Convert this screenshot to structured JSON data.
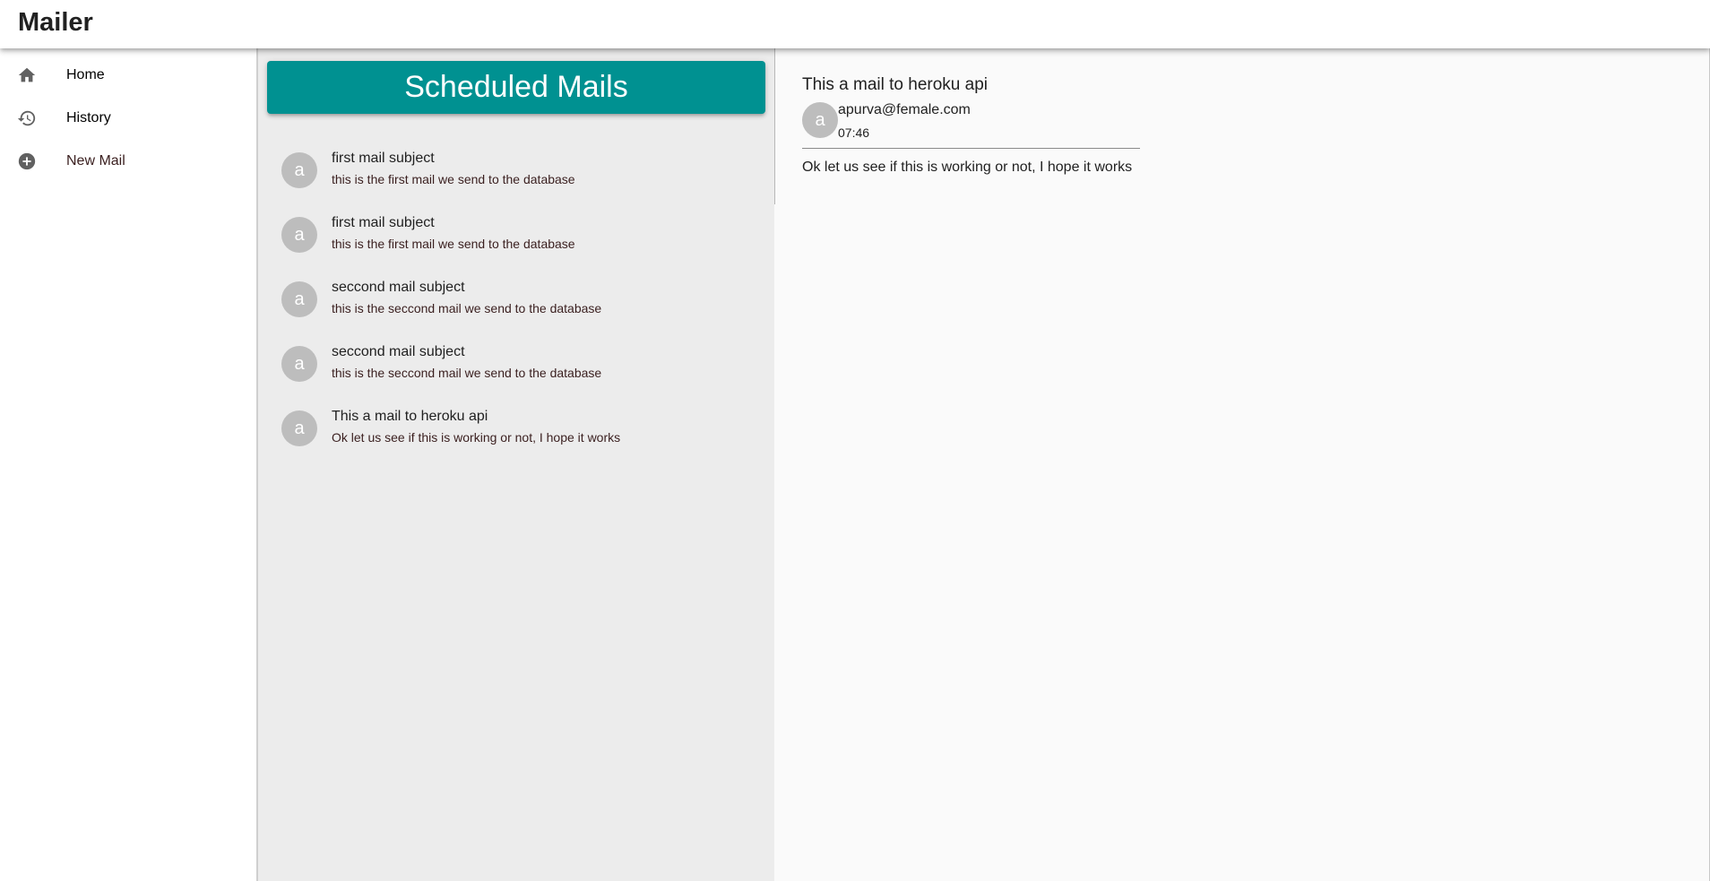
{
  "app": {
    "title": "Mailer"
  },
  "sidebar": {
    "items": [
      {
        "label": "Home",
        "icon": "home-icon"
      },
      {
        "label": "History",
        "icon": "history-icon"
      },
      {
        "label": "New Mail",
        "icon": "add-circle-icon"
      }
    ]
  },
  "list": {
    "header": "Scheduled Mails",
    "mails": [
      {
        "avatar": "a",
        "subject": "first mail subject",
        "body": "this is the first mail we send to the database"
      },
      {
        "avatar": "a",
        "subject": "first mail subject",
        "body": "this is the first mail we send to the database"
      },
      {
        "avatar": "a",
        "subject": "seccond mail subject",
        "body": "this is the seccond mail we send to the database"
      },
      {
        "avatar": "a",
        "subject": "seccond mail subject",
        "body": "this is the seccond mail we send to the database"
      },
      {
        "avatar": "a",
        "subject": "This a mail to heroku api",
        "body": "Ok let us see if this is working or not, I hope it works"
      }
    ]
  },
  "detail": {
    "subject": "This a mail to heroku api",
    "avatar": "a",
    "from": "apurva@female.com",
    "time": "07:46",
    "body": "Ok let us see if this is working or not, I hope it works"
  },
  "colors": {
    "accent": "#009191",
    "avatar": "#bdbdbd",
    "list_background": "#ececec"
  }
}
